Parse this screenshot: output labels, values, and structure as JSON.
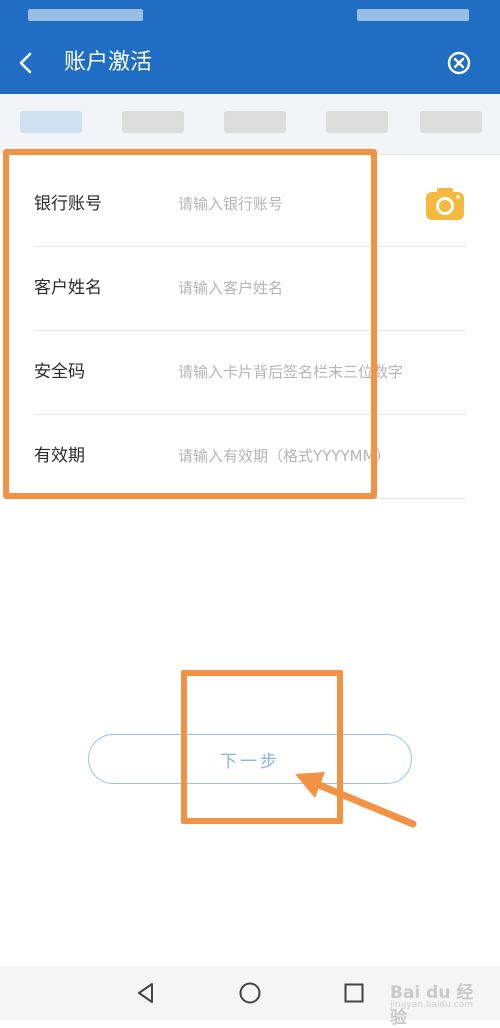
{
  "header": {
    "title": "账户激活",
    "back_icon": "chevron-left-icon",
    "close_icon": "close-circle-icon"
  },
  "form": {
    "fields": [
      {
        "label": "银行账号",
        "placeholder": "请输入银行账号",
        "value": ""
      },
      {
        "label": "客户姓名",
        "placeholder": "请输入客户姓名",
        "value": ""
      },
      {
        "label": "安全码",
        "placeholder": "请输入卡片背后签名栏末三位数字",
        "value": ""
      },
      {
        "label": "有效期",
        "placeholder": "请输入有效期（格式YYYYMM）",
        "value": ""
      }
    ],
    "camera_icon": "camera-icon"
  },
  "actions": {
    "next_label": "下一步"
  },
  "watermark": {
    "logo": "Bai du 经验",
    "url": "jingyan.baidu.com"
  },
  "colors": {
    "header_bg": "#1f6ec3",
    "highlight": "#f39243",
    "camera": "#f4b93e",
    "button_text": "#8ab4d8"
  }
}
